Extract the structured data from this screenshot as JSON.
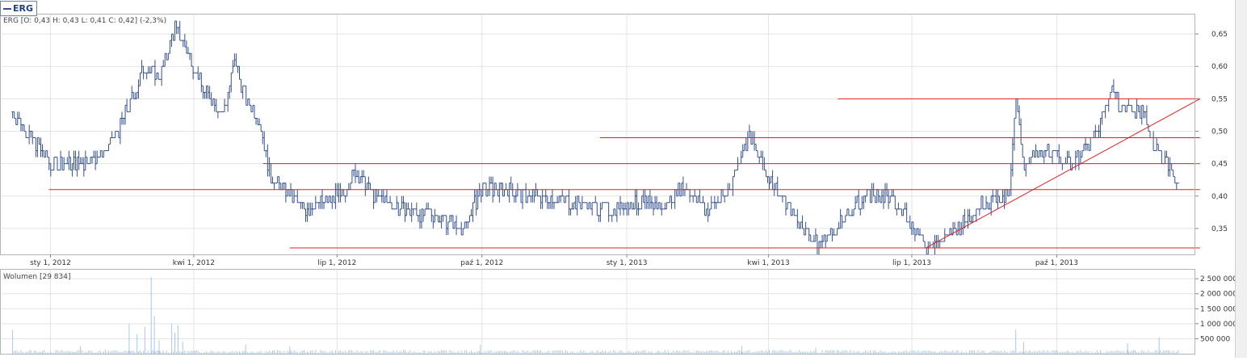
{
  "legend": {
    "symbol": "ERG"
  },
  "ohlc_label": "ERG [O: 0,43  H: 0,43  L: 0,41  C: 0,42] (-2,3%)",
  "volume_label": "Wolumen [29 834]",
  "colors": {
    "price": "#33508f",
    "volume": "#a8c8ec",
    "trendline": "#e02020",
    "grid": "#e3e3e3",
    "frame": "#b5b5b5"
  },
  "chart_data": [
    {
      "type": "ohlc",
      "title": "ERG",
      "x_ticks": [
        "sty 1, 2012",
        "kwi 1, 2012",
        "lip 1, 2012",
        "paź 1, 2012",
        "sty 1, 2013",
        "kwi 1, 2013",
        "lip 1, 2013",
        "paź 1, 2013"
      ],
      "y_ticks": [
        "0,35",
        "0,40",
        "0,45",
        "0,50",
        "0,55",
        "0,60",
        "0,65"
      ],
      "ylim": [
        0.31,
        0.68
      ],
      "x_range_months": [
        "2011-12",
        "2013-12"
      ],
      "grid": true,
      "last": {
        "open": 0.43,
        "high": 0.43,
        "low": 0.41,
        "close": 0.42,
        "change_pct": -2.3
      },
      "price_path": [
        [
          "2011-12-08",
          0.53
        ],
        [
          "2011-12-20",
          0.49
        ],
        [
          "2012-01-01",
          0.45
        ],
        [
          "2012-01-20",
          0.45
        ],
        [
          "2012-02-05",
          0.47
        ],
        [
          "2012-02-15",
          0.51
        ],
        [
          "2012-03-01",
          0.6
        ],
        [
          "2012-03-10",
          0.58
        ],
        [
          "2012-03-20",
          0.66
        ],
        [
          "2012-04-01",
          0.6
        ],
        [
          "2012-04-08",
          0.56
        ],
        [
          "2012-04-20",
          0.53
        ],
        [
          "2012-04-27",
          0.61
        ],
        [
          "2012-05-04",
          0.55
        ],
        [
          "2012-05-12",
          0.52
        ],
        [
          "2012-05-20",
          0.43
        ],
        [
          "2012-06-01",
          0.4
        ],
        [
          "2012-06-10",
          0.38
        ],
        [
          "2012-06-25",
          0.39
        ],
        [
          "2012-07-05",
          0.4
        ],
        [
          "2012-07-12",
          0.44
        ],
        [
          "2012-07-25",
          0.4
        ],
        [
          "2012-08-10",
          0.38
        ],
        [
          "2012-09-01",
          0.37
        ],
        [
          "2012-09-20",
          0.35
        ],
        [
          "2012-09-30",
          0.41
        ],
        [
          "2012-10-15",
          0.41
        ],
        [
          "2012-11-01",
          0.4
        ],
        [
          "2012-12-01",
          0.39
        ],
        [
          "2012-12-20",
          0.38
        ],
        [
          "2013-01-10",
          0.39
        ],
        [
          "2013-01-25",
          0.38
        ],
        [
          "2013-02-05",
          0.42
        ],
        [
          "2013-02-20",
          0.38
        ],
        [
          "2013-03-05",
          0.4
        ],
        [
          "2013-03-15",
          0.47
        ],
        [
          "2013-03-20",
          0.49
        ],
        [
          "2013-04-01",
          0.43
        ],
        [
          "2013-04-20",
          0.36
        ],
        [
          "2013-05-01",
          0.33
        ],
        [
          "2013-05-15",
          0.35
        ],
        [
          "2013-06-01",
          0.4
        ],
        [
          "2013-06-15",
          0.4
        ],
        [
          "2013-07-01",
          0.36
        ],
        [
          "2013-07-10",
          0.32
        ],
        [
          "2013-07-25",
          0.34
        ],
        [
          "2013-08-15",
          0.39
        ],
        [
          "2013-09-01",
          0.4
        ],
        [
          "2013-09-05",
          0.55
        ],
        [
          "2013-09-10",
          0.45
        ],
        [
          "2013-09-25",
          0.47
        ],
        [
          "2013-10-10",
          0.45
        ],
        [
          "2013-10-25",
          0.49
        ],
        [
          "2013-11-05",
          0.57
        ],
        [
          "2013-11-10",
          0.54
        ],
        [
          "2013-11-25",
          0.53
        ],
        [
          "2013-12-01",
          0.48
        ],
        [
          "2013-12-10",
          0.45
        ],
        [
          "2013-12-18",
          0.42
        ]
      ],
      "trendlines": [
        {
          "from": [
            "2011-12-31",
            0.41
          ],
          "to": [
            "2013-12-31",
            0.41
          ]
        },
        {
          "from": [
            "2012-05-15",
            0.45
          ],
          "to": [
            "2013-12-31",
            0.45
          ]
        },
        {
          "from": [
            "2012-12-15",
            0.49
          ],
          "to": [
            "2013-12-31",
            0.49
          ]
        },
        {
          "from": [
            "2013-05-15",
            0.55
          ],
          "to": [
            "2013-12-31",
            0.55
          ]
        },
        {
          "from": [
            "2012-06-01",
            0.32
          ],
          "to": [
            "2013-12-31",
            0.32
          ]
        },
        {
          "from": [
            "2013-07-10",
            0.32
          ],
          "to": [
            "2013-12-31",
            0.55
          ]
        }
      ]
    },
    {
      "type": "bar",
      "title": "Wolumen",
      "y_ticks": [
        "500 000",
        "1 000 000",
        "1 500 000",
        "2 000 000",
        "2 500 000"
      ],
      "ylim": [
        0,
        2800000
      ],
      "last_volume": 29834,
      "baseline": 90000,
      "spikes": [
        [
          "2011-12-08",
          800000
        ],
        [
          "2012-01-20",
          250000
        ],
        [
          "2012-02-05",
          150000
        ],
        [
          "2012-02-20",
          1000000
        ],
        [
          "2012-02-25",
          650000
        ],
        [
          "2012-03-01",
          900000
        ],
        [
          "2012-03-05",
          2550000
        ],
        [
          "2012-03-07",
          1250000
        ],
        [
          "2012-03-10",
          450000
        ],
        [
          "2012-03-18",
          1000000
        ],
        [
          "2012-03-20",
          700000
        ],
        [
          "2012-03-22",
          950000
        ],
        [
          "2012-03-25",
          400000
        ],
        [
          "2012-05-04",
          300000
        ],
        [
          "2012-06-01",
          250000
        ],
        [
          "2012-09-30",
          300000
        ],
        [
          "2013-03-15",
          250000
        ],
        [
          "2013-05-01",
          200000
        ],
        [
          "2013-09-05",
          800000
        ],
        [
          "2013-09-10",
          400000
        ],
        [
          "2013-11-15",
          350000
        ],
        [
          "2013-12-05",
          550000
        ]
      ]
    }
  ]
}
